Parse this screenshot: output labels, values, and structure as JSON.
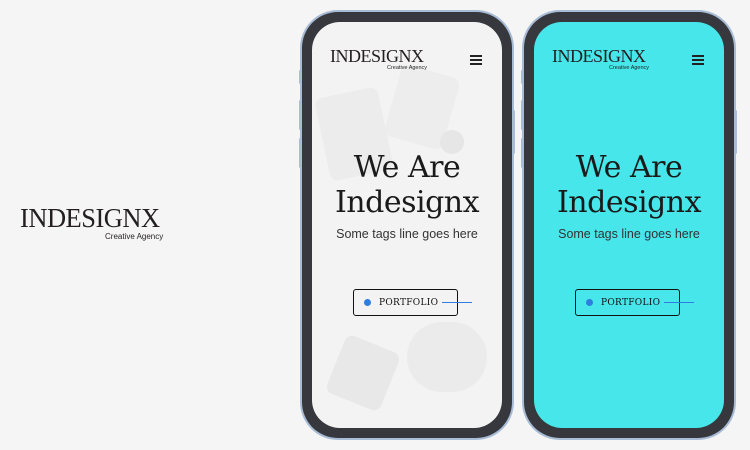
{
  "brand": {
    "logo_text": "INDESIGNX",
    "tagline": "Creative Agency"
  },
  "mockups": [
    {
      "theme": "light",
      "headline_line1": "We Are",
      "headline_line2": "Indesignx",
      "subline": "Some tags line goes here",
      "cta_label": "PORTFOLIO"
    },
    {
      "theme": "cyan",
      "headline_line1": "We Are",
      "headline_line2": "Indesignx",
      "subline": "Some tags line goes here",
      "cta_label": "PORTFOLIO"
    }
  ],
  "icons": [
    "menu-icon",
    "bullet-dot-icon"
  ],
  "colors": {
    "page_bg": "#f5f5f5",
    "phone_frame": "#36383d",
    "phone_rim": "#a9bcd6",
    "cyan_screen": "#46e6ea",
    "accent_blue": "#2f7de1",
    "text_dark": "#1a1a1a"
  }
}
